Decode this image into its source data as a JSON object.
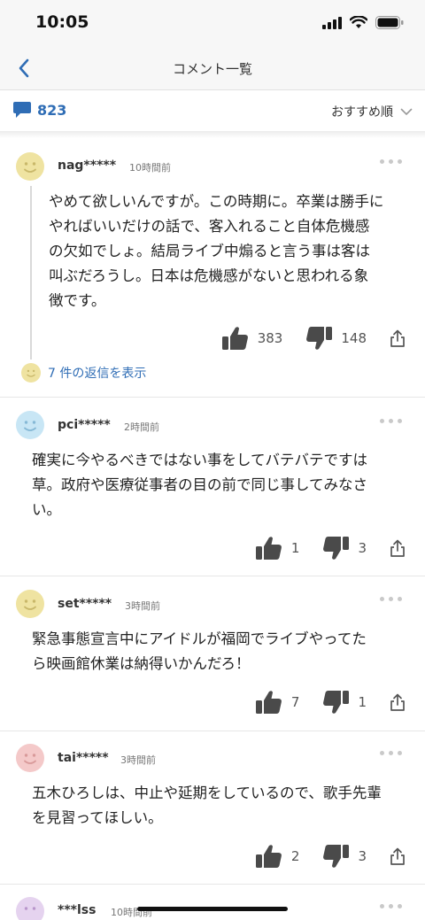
{
  "status": {
    "time": "10:05"
  },
  "nav": {
    "title": "コメント一覧"
  },
  "summary": {
    "count": "823",
    "sort_label": "おすすめ順"
  },
  "colors": {
    "accent": "#2f6db5"
  },
  "comments": [
    {
      "user": "nag*****",
      "time": "10時間前",
      "avatar_color": "#efe3a1",
      "text_lines": [
        "やめて欲しいんですが。この時期に。卒業は勝手に",
        "やればいいだけの話で、客入れること自体危機感",
        "の欠如でしょ。結局ライブ中煽ると言う事は客は",
        "叫ぶだろうし。日本は危機感がないと思われる象",
        "徴です。"
      ],
      "likes": "383",
      "dislikes": "148",
      "replies_label": "7 件の返信を表示"
    },
    {
      "user": "pci*****",
      "time": "2時間前",
      "avatar_color": "#c8e6f5",
      "text_lines": [
        "確実に今やるべきではない事をしてバテバテですは",
        "草。政府や医療従事者の目の前で同じ事してみなさ",
        "い。"
      ],
      "likes": "1",
      "dislikes": "3"
    },
    {
      "user": "set*****",
      "time": "3時間前",
      "avatar_color": "#efe3a1",
      "text_lines": [
        "緊急事態宣言中にアイドルが福岡でライブやってた",
        "ら映画館休業は納得いかんだろ！"
      ],
      "likes": "7",
      "dislikes": "1"
    },
    {
      "user": "tai*****",
      "time": "3時間前",
      "avatar_color": "#f4c9c9",
      "text_lines": [
        "五木ひろしは、中止や延期をしているので、歌手先輩",
        "を見習ってほしい。"
      ],
      "likes": "2",
      "dislikes": "3"
    },
    {
      "user": "***lss",
      "time": "10時間前",
      "avatar_color": "#e5d3ef"
    }
  ]
}
